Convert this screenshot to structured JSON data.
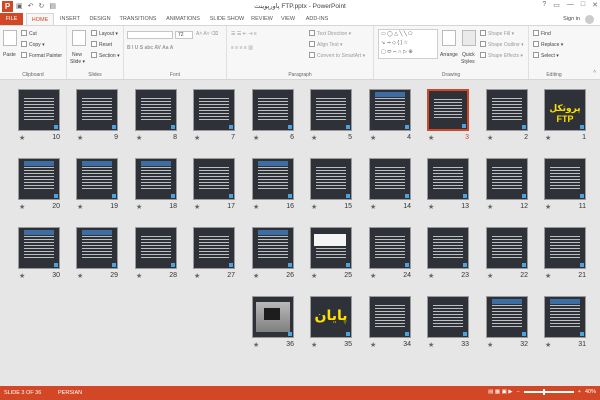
{
  "window": {
    "title": "پاورپوینت FTP.pptx - PowerPoint",
    "logo_letter": "P",
    "qat_icons": [
      "save-icon",
      "undo-icon",
      "redo-icon",
      "start-from-beginning-icon"
    ],
    "controls": [
      "?",
      "▭",
      "—",
      "□",
      "✕"
    ]
  },
  "tabs": [
    {
      "label": "FILE"
    },
    {
      "label": "HOME"
    },
    {
      "label": "INSERT"
    },
    {
      "label": "DESIGN"
    },
    {
      "label": "TRANSITIONS"
    },
    {
      "label": "ANIMATIONS"
    },
    {
      "label": "SLIDE SHOW"
    },
    {
      "label": "REVIEW"
    },
    {
      "label": "VIEW"
    },
    {
      "label": "ADD-INS"
    }
  ],
  "active_tab": "HOME",
  "signin": "Sign in",
  "ribbon": {
    "clipboard": {
      "label": "Clipboard",
      "paste": "Paste",
      "cut": "Cut",
      "copy": "Copy",
      "format_painter": "Format Painter"
    },
    "slides": {
      "label": "Slides",
      "new_slide": "New",
      "new_slide2": "Slide",
      "layout": "Layout",
      "reset": "Reset",
      "section": "Section"
    },
    "font": {
      "label": "Font",
      "size": "72"
    },
    "paragraph": {
      "label": "Paragraph",
      "text_direction": "Text Direction",
      "align_text": "Align Text",
      "convert": "Convert to SmartArt"
    },
    "drawing": {
      "label": "Drawing",
      "arrange": "Arrange",
      "quick_styles": "Quick",
      "quick_styles2": "Styles",
      "shape_fill": "Shape Fill",
      "shape_outline": "Shape Outline",
      "shape_effects": "Shape Effects"
    },
    "editing": {
      "label": "Editing",
      "find": "Find",
      "replace": "Replace",
      "select": "Select"
    }
  },
  "slides": [
    {
      "n": "1",
      "variant": "yellowtitle",
      "title": "پروتکل FTP"
    },
    {
      "n": "2",
      "variant": "text"
    },
    {
      "n": "3",
      "variant": "text",
      "selected": true
    },
    {
      "n": "4",
      "variant": "header"
    },
    {
      "n": "5",
      "variant": "text"
    },
    {
      "n": "6",
      "variant": "text"
    },
    {
      "n": "7",
      "variant": "text"
    },
    {
      "n": "8",
      "variant": "text"
    },
    {
      "n": "9",
      "variant": "text"
    },
    {
      "n": "10",
      "variant": "text"
    },
    {
      "n": "11",
      "variant": "text"
    },
    {
      "n": "12",
      "variant": "text"
    },
    {
      "n": "13",
      "variant": "text"
    },
    {
      "n": "14",
      "variant": "text"
    },
    {
      "n": "15",
      "variant": "text"
    },
    {
      "n": "16",
      "variant": "header"
    },
    {
      "n": "17",
      "variant": "text"
    },
    {
      "n": "18",
      "variant": "header"
    },
    {
      "n": "19",
      "variant": "header"
    },
    {
      "n": "20",
      "variant": "header"
    },
    {
      "n": "21",
      "variant": "text"
    },
    {
      "n": "22",
      "variant": "text"
    },
    {
      "n": "23",
      "variant": "text"
    },
    {
      "n": "24",
      "variant": "text"
    },
    {
      "n": "25",
      "variant": "light"
    },
    {
      "n": "26",
      "variant": "header"
    },
    {
      "n": "27",
      "variant": "text"
    },
    {
      "n": "28",
      "variant": "text"
    },
    {
      "n": "29",
      "variant": "header"
    },
    {
      "n": "30",
      "variant": "header"
    },
    {
      "n": "31",
      "variant": "header"
    },
    {
      "n": "32",
      "variant": "header"
    },
    {
      "n": "33",
      "variant": "text"
    },
    {
      "n": "34",
      "variant": "text"
    },
    {
      "n": "35",
      "variant": "bigyellow",
      "title": "پایان"
    },
    {
      "n": "36",
      "variant": "laptop"
    }
  ],
  "status": {
    "slide_info": "SLIDE 3 OF 36",
    "language": "PERSIAN",
    "zoom": "40%",
    "zoom_fraction": 0.4
  }
}
